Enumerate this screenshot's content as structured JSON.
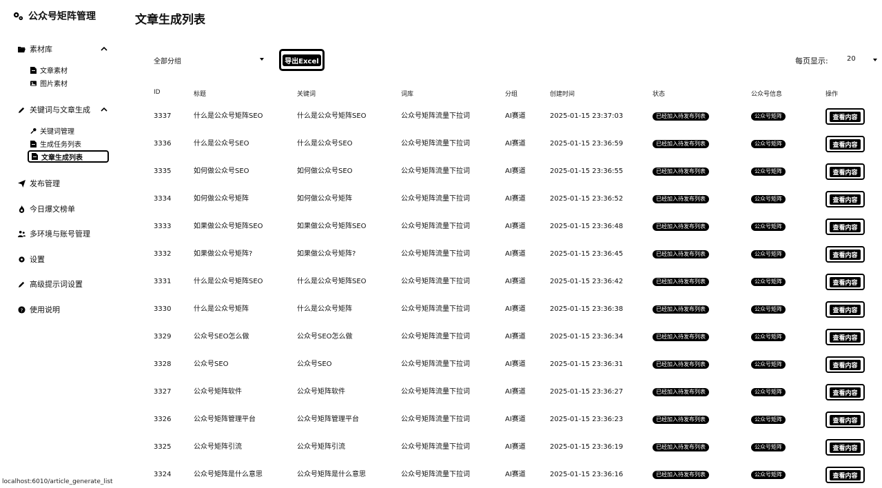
{
  "app": {
    "title": "公众号矩阵管理"
  },
  "sidebar": {
    "groups": [
      {
        "label": "素材库",
        "subitems": [
          {
            "label": "文章素材"
          },
          {
            "label": "图片素材"
          }
        ]
      },
      {
        "label": "关键词与文章生成",
        "subitems": [
          {
            "label": "关键词管理"
          },
          {
            "label": "生成任务列表"
          },
          {
            "label": "文章生成列表"
          }
        ]
      }
    ],
    "items": [
      {
        "label": "发布管理"
      },
      {
        "label": "今日爆文榜单"
      },
      {
        "label": "多环境与账号管理"
      },
      {
        "label": "设置"
      },
      {
        "label": "高级提示词设置"
      },
      {
        "label": "使用说明"
      }
    ]
  },
  "main": {
    "title": "文章生成列表",
    "filter": {
      "group_value": "全部分组"
    },
    "export_label": "导出Excel",
    "page_size_label": "每页显示:",
    "page_size_value": "20",
    "columns": [
      "ID",
      "标题",
      "关键词",
      "词库",
      "分组",
      "创建时间",
      "状态",
      "公众号信息",
      "操作"
    ],
    "rows": [
      {
        "id": "3337",
        "title": "什么是公众号矩阵SEO",
        "keyword": "什么是公众号矩阵SEO",
        "lexicon": "公众号矩阵流量下拉词",
        "group": "AI赛道",
        "created": "2025-01-15 23:37:03",
        "status": "已经加入待发布列表",
        "account": "公众号矩阵",
        "action": "查看内容"
      },
      {
        "id": "3336",
        "title": "什么是公众号SEO",
        "keyword": "什么是公众号SEO",
        "lexicon": "公众号矩阵流量下拉词",
        "group": "AI赛道",
        "created": "2025-01-15 23:36:59",
        "status": "已经加入待发布列表",
        "account": "公众号矩阵",
        "action": "查看内容"
      },
      {
        "id": "3335",
        "title": "如何做公众号SEO",
        "keyword": "如何做公众号SEO",
        "lexicon": "公众号矩阵流量下拉词",
        "group": "AI赛道",
        "created": "2025-01-15 23:36:55",
        "status": "已经加入待发布列表",
        "account": "公众号矩阵",
        "action": "查看内容"
      },
      {
        "id": "3334",
        "title": "如何做公众号矩阵",
        "keyword": "如何做公众号矩阵",
        "lexicon": "公众号矩阵流量下拉词",
        "group": "AI赛道",
        "created": "2025-01-15 23:36:52",
        "status": "已经加入待发布列表",
        "account": "公众号矩阵",
        "action": "查看内容"
      },
      {
        "id": "3333",
        "title": "如果做公众号矩阵SEO",
        "keyword": "如果做公众号矩阵SEO",
        "lexicon": "公众号矩阵流量下拉词",
        "group": "AI赛道",
        "created": "2025-01-15 23:36:48",
        "status": "已经加入待发布列表",
        "account": "公众号矩阵",
        "action": "查看内容"
      },
      {
        "id": "3332",
        "title": "如果做公众号矩阵?",
        "keyword": "如果做公众号矩阵?",
        "lexicon": "公众号矩阵流量下拉词",
        "group": "AI赛道",
        "created": "2025-01-15 23:36:45",
        "status": "已经加入待发布列表",
        "account": "公众号矩阵",
        "action": "查看内容"
      },
      {
        "id": "3331",
        "title": "什么是公众号矩阵SEO",
        "keyword": "什么是公众号矩阵SEO",
        "lexicon": "公众号矩阵流量下拉词",
        "group": "AI赛道",
        "created": "2025-01-15 23:36:42",
        "status": "已经加入待发布列表",
        "account": "公众号矩阵",
        "action": "查看内容"
      },
      {
        "id": "3330",
        "title": "什么是公众号矩阵",
        "keyword": "什么是公众号矩阵",
        "lexicon": "公众号矩阵流量下拉词",
        "group": "AI赛道",
        "created": "2025-01-15 23:36:38",
        "status": "已经加入待发布列表",
        "account": "公众号矩阵",
        "action": "查看内容"
      },
      {
        "id": "3329",
        "title": "公众号SEO怎么做",
        "keyword": "公众号SEO怎么做",
        "lexicon": "公众号矩阵流量下拉词",
        "group": "AI赛道",
        "created": "2025-01-15 23:36:34",
        "status": "已经加入待发布列表",
        "account": "公众号矩阵",
        "action": "查看内容"
      },
      {
        "id": "3328",
        "title": "公众号SEO",
        "keyword": "公众号SEO",
        "lexicon": "公众号矩阵流量下拉词",
        "group": "AI赛道",
        "created": "2025-01-15 23:36:31",
        "status": "已经加入待发布列表",
        "account": "公众号矩阵",
        "action": "查看内容"
      },
      {
        "id": "3327",
        "title": "公众号矩阵软件",
        "keyword": "公众号矩阵软件",
        "lexicon": "公众号矩阵流量下拉词",
        "group": "AI赛道",
        "created": "2025-01-15 23:36:27",
        "status": "已经加入待发布列表",
        "account": "公众号矩阵",
        "action": "查看内容"
      },
      {
        "id": "3326",
        "title": "公众号矩阵管理平台",
        "keyword": "公众号矩阵管理平台",
        "lexicon": "公众号矩阵流量下拉词",
        "group": "AI赛道",
        "created": "2025-01-15 23:36:23",
        "status": "已经加入待发布列表",
        "account": "公众号矩阵",
        "action": "查看内容"
      },
      {
        "id": "3325",
        "title": "公众号矩阵引流",
        "keyword": "公众号矩阵引流",
        "lexicon": "公众号矩阵流量下拉词",
        "group": "AI赛道",
        "created": "2025-01-15 23:36:19",
        "status": "已经加入待发布列表",
        "account": "公众号矩阵",
        "action": "查看内容"
      },
      {
        "id": "3324",
        "title": "公众号矩阵是什么意思",
        "keyword": "公众号矩阵是什么意思",
        "lexicon": "公众号矩阵流量下拉词",
        "group": "AI赛道",
        "created": "2025-01-15 23:36:16",
        "status": "已经加入待发布列表",
        "account": "公众号矩阵",
        "action": "查看内容"
      }
    ]
  },
  "statusbar": {
    "url": "localhost:6010/article_generate_list"
  }
}
